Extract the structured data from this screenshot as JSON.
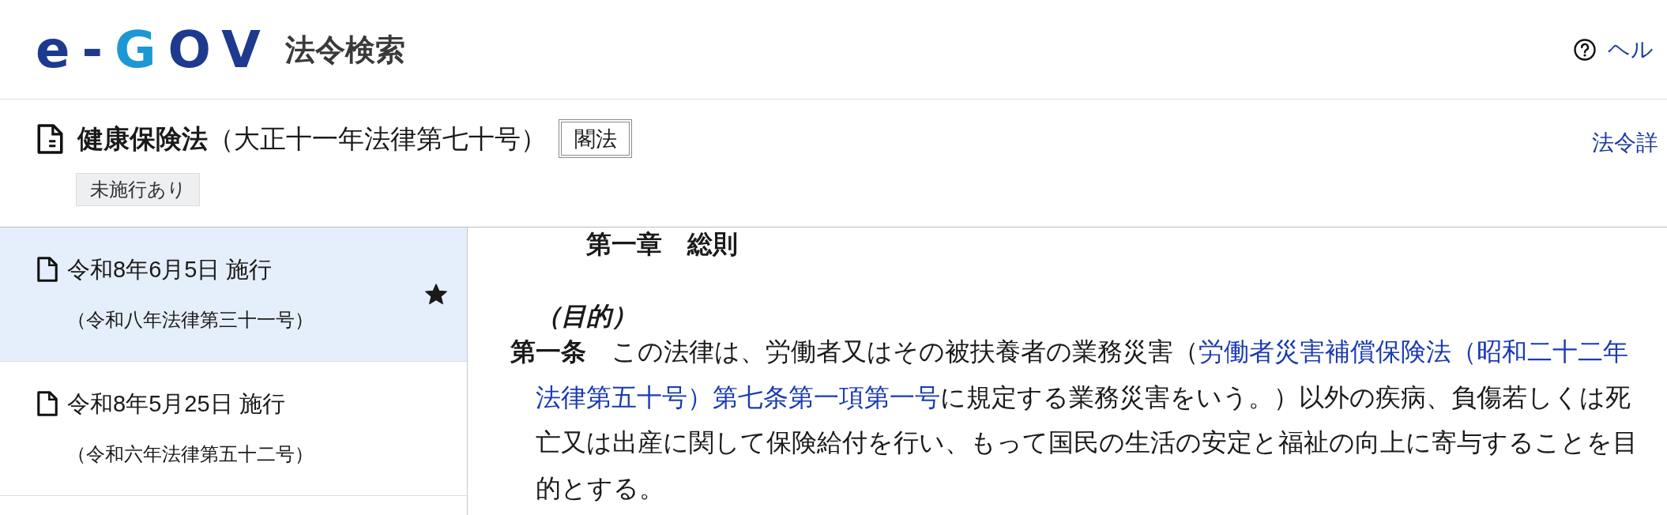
{
  "header": {
    "logo": [
      {
        "text": "e-",
        "accent": false
      },
      {
        "text": "G",
        "accent": true
      },
      {
        "text": "OV",
        "accent": false
      }
    ],
    "service_name": "法令検索",
    "help_link": "ヘル"
  },
  "law": {
    "title": "**健康保険法**（大正十一年法律第七十号）",
    "type_label": "閣法",
    "status_tag": "未施行あり",
    "details_link": "法令詳"
  },
  "revisions": [
    {
      "date": "令和8年6月5日 施行",
      "law_number": "（令和八年法律第三十一号）",
      "selected": true,
      "starred": true
    },
    {
      "date": "令和8年5月25日 施行",
      "law_number": "（令和六年法律第五十二号）",
      "selected": false,
      "starred": false
    }
  ],
  "content": {
    "chapter_title": "第一章　総則",
    "article_caption": "（目的）",
    "article": {
      "number": "第一条",
      "segments": [
        {
          "kind": "text",
          "text": "この法律は、労働者又はその被扶養者の業務災害（"
        },
        {
          "kind": "link",
          "text": "労働者災害補償保険法（昭和二十二年"
        },
        {
          "kind": "link",
          "text": "法律第五十号）"
        },
        {
          "kind": "link",
          "text": "第七条第一項第一号"
        },
        {
          "kind": "text",
          "text": "に規定する業務災害をいう。）以外の疾病、負傷若しくは死亡又は出産に関して保険給付を行い、もって国民の生活の安定と福祉の向上に寄与することを目的とする。"
        }
      ]
    }
  }
}
